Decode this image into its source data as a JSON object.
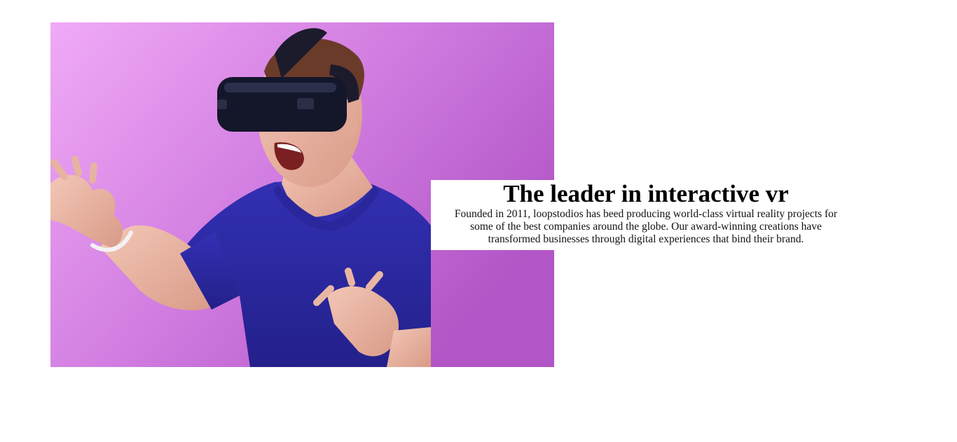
{
  "hero": {
    "image_subject": "man-wearing-vr-headset",
    "background_colors": [
      "#f0a8f4",
      "#b558c8"
    ],
    "shirt_color": "#2e2aa3"
  },
  "intro": {
    "heading": "The leader in interactive vr",
    "body": "Founded in 2011, loopstodios has beed producing world-class virtual reality projects for some of the best companies around the globe. Our award-winning creations have transformed businesses through digital experiences that bind their brand."
  }
}
